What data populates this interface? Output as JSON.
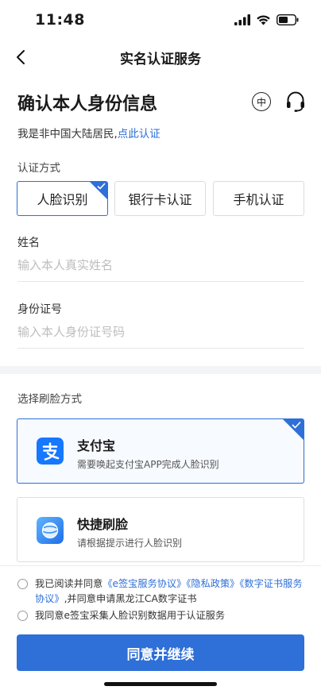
{
  "status_bar": {
    "time": "11:48"
  },
  "nav": {
    "title": "实名认证服务"
  },
  "header": {
    "title": "确认本人身份信息",
    "lang_label": "中",
    "resident_prefix": "我是非中国大陆居民,",
    "resident_link": "点此认证"
  },
  "auth_method": {
    "label": "认证方式",
    "options": [
      {
        "label": "人脸识别",
        "selected": true
      },
      {
        "label": "银行卡认证",
        "selected": false
      },
      {
        "label": "手机认证",
        "selected": false
      }
    ]
  },
  "form": {
    "name": {
      "label": "姓名",
      "placeholder": "输入本人真实姓名",
      "value": ""
    },
    "id_number": {
      "label": "身份证号",
      "placeholder": "输入本人身份证号码",
      "value": ""
    }
  },
  "face_method": {
    "label": "选择刷脸方式",
    "options": [
      {
        "title": "支付宝",
        "desc": "需要唤起支付宝APP完成人脸识别",
        "selected": true
      },
      {
        "title": "快捷刷脸",
        "desc": "请根据提示进行人脸识别",
        "selected": false
      }
    ]
  },
  "agreements": {
    "first": {
      "prefix": "我已阅读并同意",
      "links": [
        "《e签宝服务协议》",
        "《隐私政策》",
        "《数字证书服务协议》"
      ],
      "suffix": ",并同意申请黑龙江CA数字证书"
    },
    "second": {
      "text": "我同意e签宝采集人脸识别数据用于认证服务"
    }
  },
  "submit": {
    "label": "同意并继续"
  },
  "colors": {
    "accent": "#2e6fd8",
    "alipay": "#1677ff"
  }
}
